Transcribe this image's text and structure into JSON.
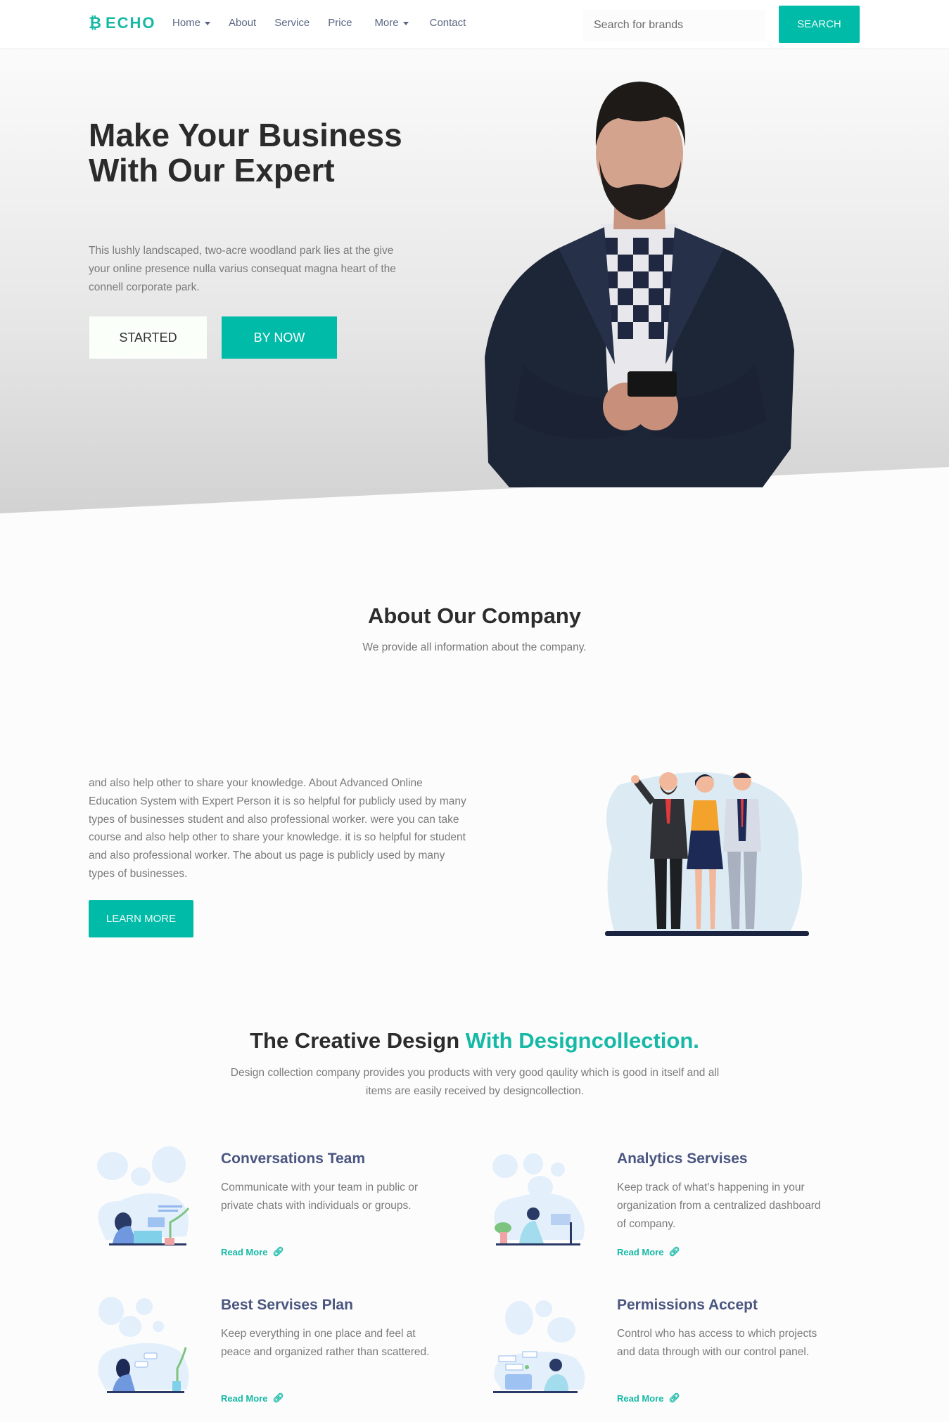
{
  "navbar": {
    "brand": "ECHO",
    "brand_icon": "bitcoin-icon",
    "links": [
      {
        "label": "Home",
        "dropdown": true
      },
      {
        "label": "About",
        "dropdown": false
      },
      {
        "label": "Service",
        "dropdown": false
      },
      {
        "label": "Price",
        "dropdown": false
      },
      {
        "label": "More",
        "dropdown": true
      },
      {
        "label": "Contact",
        "dropdown": false
      }
    ],
    "search_placeholder": "Search for brands",
    "search_button": "SEARCH"
  },
  "hero": {
    "title": "Make Your Business With Our Expert",
    "text": "This lushly landscaped, two-acre woodland park lies at the give your online presence nulla varius consequat magna heart of the connell corporate park.",
    "button_primary": "STARTED",
    "button_secondary": "BY NOW",
    "image": "man-with-phone-photo"
  },
  "about": {
    "title": "About Our Company",
    "subtitle": "We provide all information about the company.",
    "text": "and also help other to share your knowledge. About Advanced Online Education System with Expert Person it is so helpful for publicly used by many types of businesses student and also professional worker. were you can take course and also help other to share your knowledge. it is so helpful for student and also professional worker. The about us page is publicly used by many types of businesses.",
    "button": "LEARN MORE",
    "image": "team-illustration"
  },
  "creative": {
    "title_plain": "The Creative Design ",
    "title_accent": "With Designcollection.",
    "subtitle": "Design collection company provides you products with very good qaulity which is good in itself and all items are easily received by designcollection."
  },
  "features": [
    {
      "title": "Conversations Team",
      "text": "Communicate with your team in public or private chats with individuals or groups.",
      "link": "Read More",
      "icon": "link-icon"
    },
    {
      "title": "Analytics Servises",
      "text": "Keep track of what's happening in your organization from a centralized dashboard of company.",
      "link": "Read More",
      "icon": "link-icon"
    },
    {
      "title": "Best Servises Plan",
      "text": "Keep everything in one place and feel at peace and organized rather than scattered.",
      "link": "Read More",
      "icon": "link-icon"
    },
    {
      "title": "Permissions Accept",
      "text": "Control who has access to which projects and data through with our control panel.",
      "link": "Read More",
      "icon": "link-icon"
    }
  ],
  "colors": {
    "accent": "#00bba7",
    "heading": "#2b2b2b",
    "feature_title": "#4a5680",
    "body_text": "#7a7a7a"
  }
}
